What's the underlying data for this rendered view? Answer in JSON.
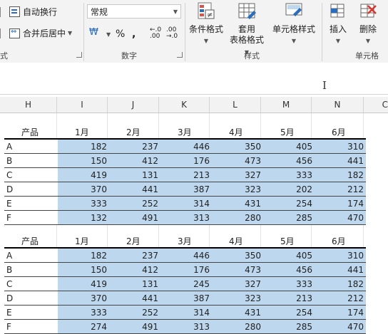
{
  "ribbon": {
    "alignment": {
      "wrap_text": "自动换行",
      "merge_center": "合并后居中",
      "group_label_partial": "式"
    },
    "number": {
      "format_value": "常规",
      "percent": "%",
      "comma": ",",
      "inc_decimal": "←.0 .00",
      "dec_decimal": ".00 →.0",
      "group_label": "数字"
    },
    "styles": {
      "conditional_format": "条件格式",
      "table_format_line1": "套用",
      "table_format_line2": "表格格式",
      "cell_styles": "单元格样式",
      "group_label": "样式"
    },
    "cells": {
      "insert": "插入",
      "delete": "删除",
      "group_label": "单元格"
    }
  },
  "columns": [
    "H",
    "I",
    "J",
    "K",
    "L",
    "M",
    "N",
    "C"
  ],
  "tables": [
    {
      "header": [
        "产品",
        "1月",
        "2月",
        "3月",
        "4月",
        "5月",
        "6月"
      ],
      "rows": [
        [
          "A",
          "182",
          "237",
          "446",
          "350",
          "405",
          "310"
        ],
        [
          "B",
          "150",
          "412",
          "176",
          "473",
          "456",
          "441"
        ],
        [
          "C",
          "419",
          "131",
          "213",
          "327",
          "333",
          "182"
        ],
        [
          "D",
          "370",
          "441",
          "387",
          "323",
          "202",
          "212"
        ],
        [
          "E",
          "333",
          "252",
          "314",
          "431",
          "254",
          "174"
        ],
        [
          "F",
          "132",
          "491",
          "313",
          "280",
          "285",
          "470"
        ]
      ]
    },
    {
      "header": [
        "产品",
        "1月",
        "2月",
        "3月",
        "4月",
        "5月",
        "6月"
      ],
      "rows": [
        [
          "A",
          "182",
          "237",
          "446",
          "350",
          "405",
          "310"
        ],
        [
          "B",
          "150",
          "412",
          "176",
          "473",
          "456",
          "441"
        ],
        [
          "C",
          "419",
          "131",
          "245",
          "327",
          "333",
          "182"
        ],
        [
          "D",
          "370",
          "441",
          "387",
          "323",
          "213",
          "212"
        ],
        [
          "E",
          "333",
          "252",
          "314",
          "431",
          "254",
          "174"
        ],
        [
          "F",
          "274",
          "491",
          "313",
          "280",
          "285",
          "470"
        ]
      ]
    }
  ],
  "colors": {
    "highlight": "#bdd7ee",
    "ribbon_bg": "#f3f3f3"
  }
}
